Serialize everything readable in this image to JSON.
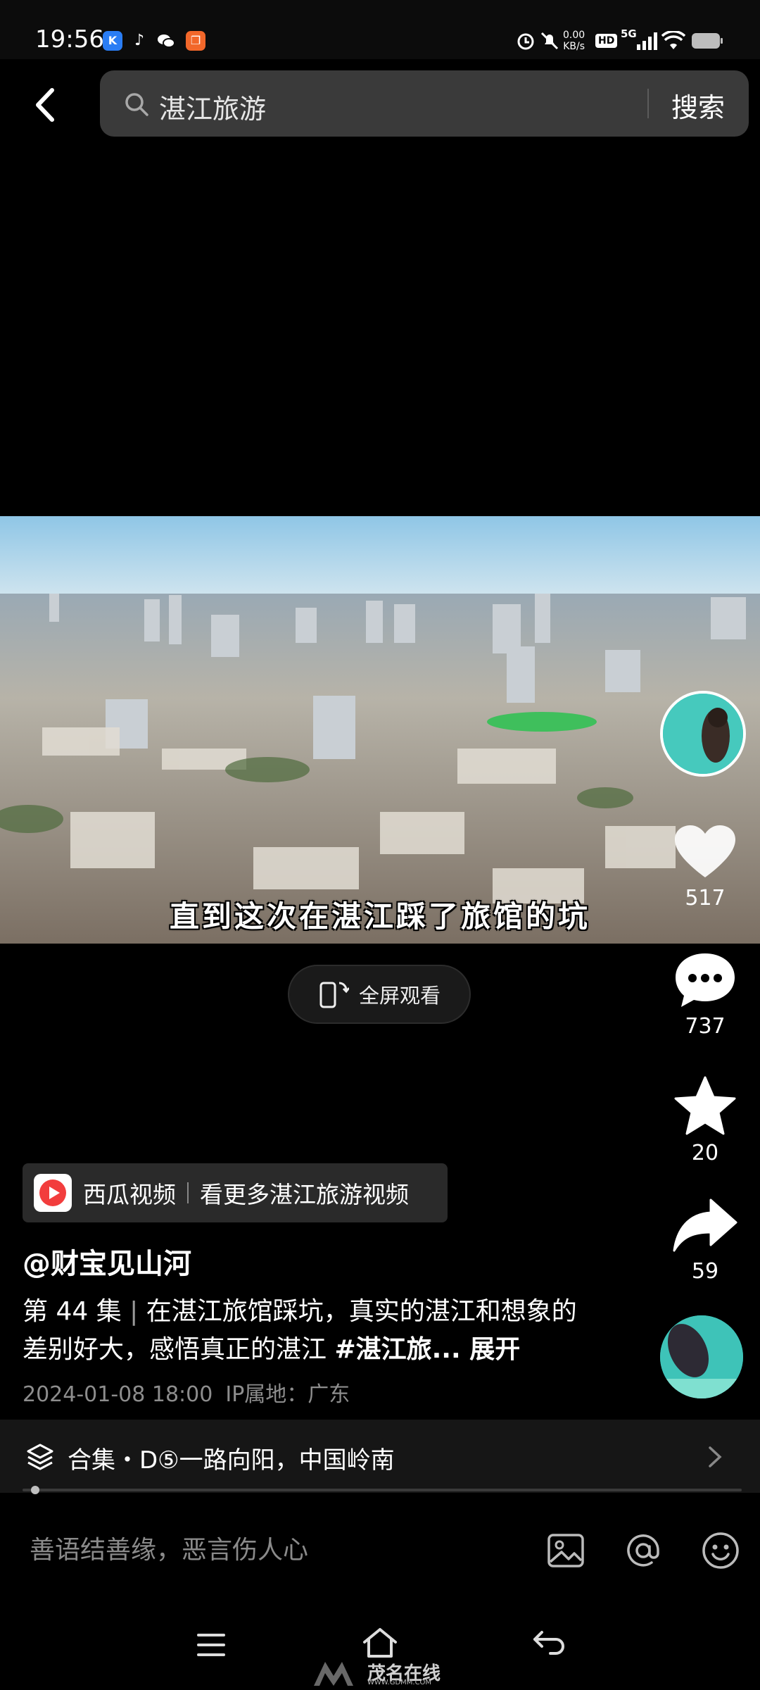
{
  "status_bar": {
    "time": "19:56",
    "network_speed_value": "0.00",
    "network_speed_unit": "KB/s",
    "network_type": "5G",
    "hd_label": "HD",
    "app_icons": [
      "kwai-icon",
      "tiktok-icon",
      "wechat-icon",
      "app-icon"
    ]
  },
  "search": {
    "query": "湛江旅游",
    "button_label": "搜索"
  },
  "video": {
    "subtitle": "直到这次在湛江踩了旅馆的坑",
    "fullscreen_label": "全屏观看"
  },
  "actions": {
    "likes": "517",
    "comments": "737",
    "favorites": "20",
    "shares": "59"
  },
  "banner": {
    "app_name": "西瓜视频",
    "text": "看更多湛江旅游视频"
  },
  "post": {
    "author": "@财宝见山河",
    "episode": "第 44 集",
    "description": "在湛江旅馆踩坑，真实的湛江和想象的差别好大，感悟真正的湛江 ",
    "hashtag": "#湛江旅...",
    "expand_label": " 展开",
    "date": "2024-01-08 18:00",
    "ip_location": "IP属地：广东"
  },
  "collection": {
    "label": "合集・D⑤一路向阳，中国岭南"
  },
  "comment_bar": {
    "placeholder": "善语结善缘，恶言伤人心"
  },
  "watermark": {
    "text": "茂名在线",
    "subtext": "WWW.GDMM.COM"
  },
  "colors": {
    "background": "#000000",
    "search_bg": "#3a3a3a",
    "muted_text": "#8d8d8d"
  }
}
